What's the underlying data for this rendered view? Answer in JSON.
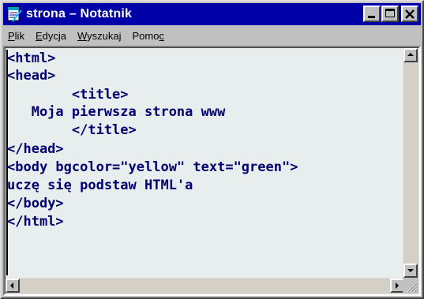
{
  "window": {
    "title": "strona – Notatnik",
    "app_icon": "notepad-icon",
    "controls": {
      "minimize_icon": "minimize-icon",
      "maximize_icon": "maximize-icon",
      "close_icon": "close-icon"
    }
  },
  "menu": [
    {
      "label": "Plik",
      "mnemonic": "P"
    },
    {
      "label": "Edycja",
      "mnemonic": "E"
    },
    {
      "label": "Wyszukaj",
      "mnemonic": "W"
    },
    {
      "label": "Pomoc",
      "mnemonic": "c"
    }
  ],
  "document": {
    "lines": [
      "<html>",
      "<head>",
      "        <title>",
      "   Moja pierwsza strona www",
      "        </title>",
      "</head>",
      "<body bgcolor=\"yellow\" text=\"green\">",
      "uczę się podstaw HTML'a",
      "</body>",
      "</html>"
    ]
  },
  "colors": {
    "titlebar": "#0000a8",
    "text": "#000070",
    "editor_background": "#e8eeee"
  }
}
